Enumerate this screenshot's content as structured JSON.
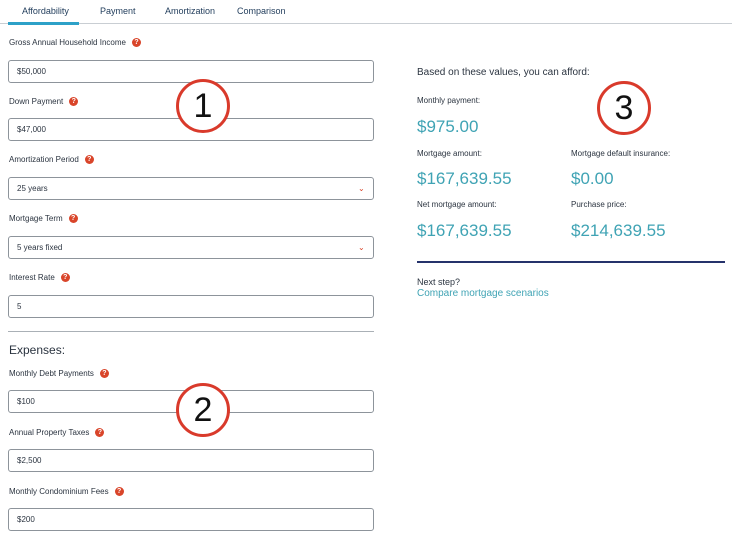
{
  "tabs": [
    {
      "label": "Affordability"
    },
    {
      "label": "Payment"
    },
    {
      "label": "Amortization"
    },
    {
      "label": "Comparison"
    }
  ],
  "form": {
    "income_label": "Gross Annual Household Income",
    "income_value": "$50,000",
    "down_label": "Down Payment",
    "down_value": "$47,000",
    "amort_label": "Amortization Period",
    "amort_value": "25 years",
    "term_label": "Mortgage Term",
    "term_value": "5 years fixed",
    "rate_label": "Interest Rate",
    "rate_value": "5"
  },
  "expenses": {
    "title": "Expenses:",
    "debt_label": "Monthly Debt Payments",
    "debt_value": "$100",
    "tax_label": "Annual Property Taxes",
    "tax_value": "$2,500",
    "condo_label": "Monthly Condominium Fees",
    "condo_value": "$200"
  },
  "results": {
    "heading": "Based on these values, you can afford:",
    "monthly_label": "Monthly payment:",
    "monthly_value": "$975.00",
    "mortgage_label": "Mortgage amount:",
    "mortgage_value": "$167,639.55",
    "insurance_label": "Mortgage default insurance:",
    "insurance_value": "$0.00",
    "net_label": "Net mortgage amount:",
    "net_value": "$167,639.55",
    "price_label": "Purchase price:",
    "price_value": "$214,639.55",
    "next_label": "Next step?",
    "link_label": "Compare mortgage scenarios"
  },
  "annotations": [
    "1",
    "2",
    "3"
  ],
  "colors": {
    "accent": "#2da1c8",
    "value": "#3fa3b4",
    "help": "#d9452a",
    "marker": "#d93a2b"
  }
}
